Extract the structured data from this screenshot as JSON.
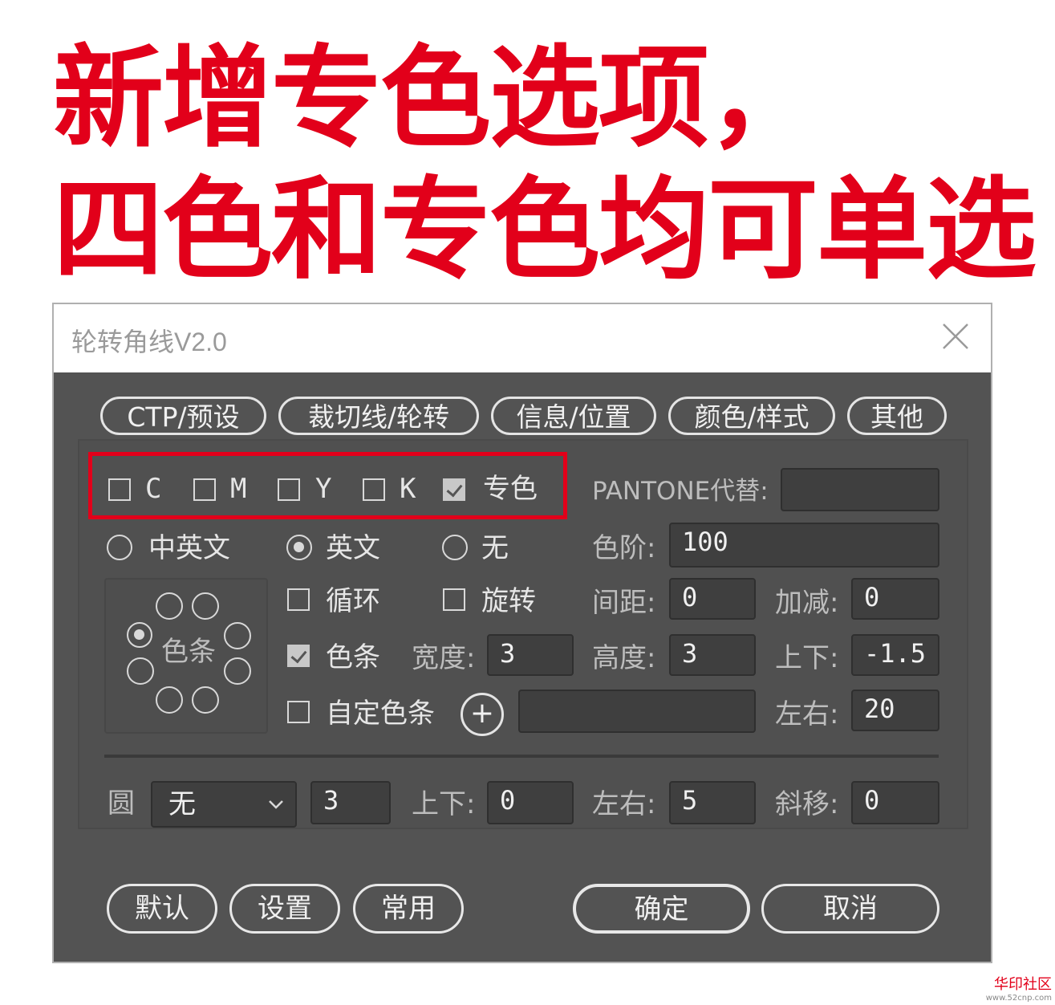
{
  "headline": {
    "line1": "新增专色选项，",
    "line2": "四色和专色均可单选"
  },
  "dialog": {
    "title": "轮转角线V2.0",
    "tabs": [
      "CTP/预设",
      "裁切线/轮转",
      "信息/位置",
      "颜色/样式",
      "其他"
    ],
    "color_checks": [
      {
        "label": "C",
        "checked": false
      },
      {
        "label": "M",
        "checked": false
      },
      {
        "label": "Y",
        "checked": false
      },
      {
        "label": "K",
        "checked": false
      },
      {
        "label": "专色",
        "checked": true
      }
    ],
    "pantone_label": "PANTONE代替:",
    "pantone_value": "",
    "lang_radios": [
      {
        "label": "中英文",
        "selected": false
      },
      {
        "label": "英文",
        "selected": true
      },
      {
        "label": "无",
        "selected": false
      }
    ],
    "level_label": "色阶:",
    "level_value": "100",
    "loop_label": "循环",
    "rotate_label": "旋转",
    "spacing_label": "间距:",
    "spacing_value": "0",
    "addsub_label": "加减:",
    "addsub_value": "0",
    "colorbar_center_label": "色条",
    "colorbar_label": "色条",
    "colorbar_checked": true,
    "width_label": "宽度:",
    "width_value": "3",
    "height_label": "高度:",
    "height_value": "3",
    "updown_label": "上下:",
    "updown_value": "-1.5",
    "custom_bar_label": "自定色条",
    "custom_bar_value": "",
    "plus_symbol": "+",
    "leftright_label": "左右:",
    "leftright_value": "20",
    "circle_label": "圆",
    "circle_select": "无",
    "circle_size": "3",
    "c_updown_label": "上下:",
    "c_updown_value": "0",
    "c_leftright_label": "左右:",
    "c_leftright_value": "5",
    "c_skew_label": "斜移:",
    "c_skew_value": "0",
    "buttons": {
      "default": "默认",
      "settings": "设置",
      "common": "常用",
      "ok": "确定",
      "cancel": "取消"
    }
  },
  "watermark": {
    "brand": "华印社区",
    "site": "www.52cnp.com"
  },
  "colors": {
    "accent_red": "#e2001a",
    "dialog_bg": "#535353",
    "field_bg": "#3f3f3f"
  }
}
